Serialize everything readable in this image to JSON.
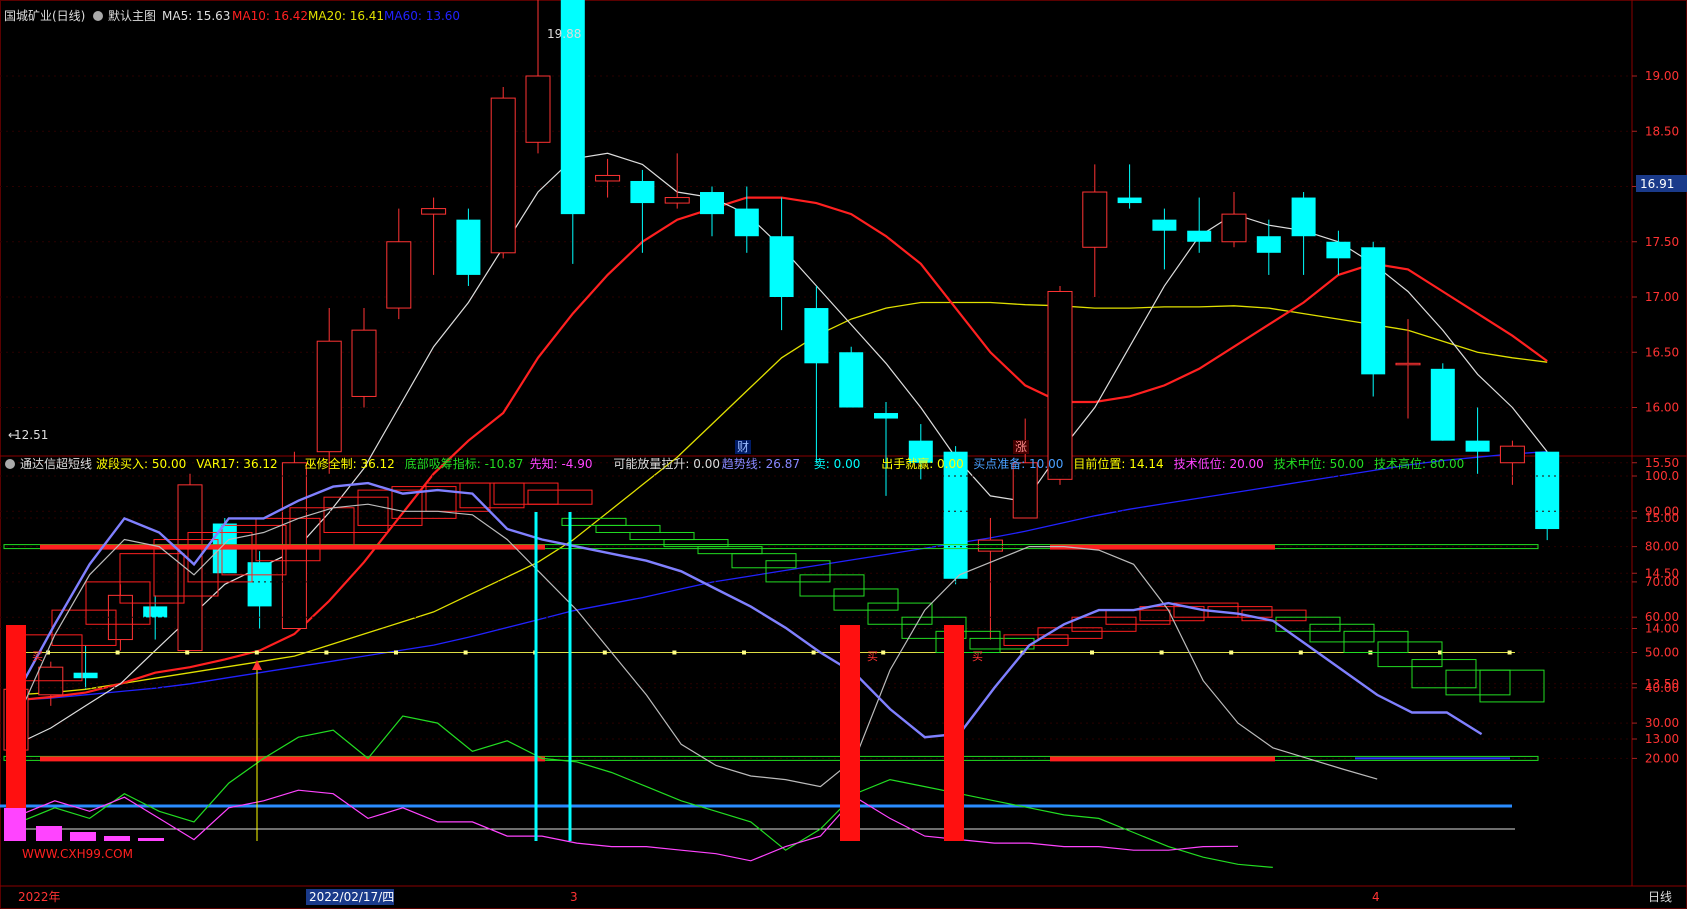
{
  "header": {
    "stock_title": "国城矿业(日线)",
    "template_label": "默认主图",
    "ma5_label": "MA5: 15.63",
    "ma10_label": "MA10: 16.42",
    "ma20_label": "MA20: 16.41",
    "ma60_label": "MA60: 13.60"
  },
  "indicator_header": {
    "name": "通达信超短线",
    "items": [
      {
        "text": "波段买入: 50.00",
        "color": "#ffff00"
      },
      {
        "text": "VAR17: 36.12",
        "color": "#ffff00"
      },
      {
        "text": "巫修全制: 36.12",
        "color": "#ffff00"
      },
      {
        "text": "底部吸筹指标: -10.87",
        "color": "#22dd22"
      },
      {
        "text": "先知: -4.90",
        "color": "#ff44ff"
      },
      {
        "text": "可能放量拉升: 0.00",
        "color": "#dddddd"
      },
      {
        "text": "趋势线: 26.87",
        "color": "#8888ff"
      },
      {
        "text": "卖: 0.00",
        "color": "#00ffff"
      },
      {
        "text": "出手就赢: 0.00",
        "color": "#ffff00"
      },
      {
        "text": "买点准备: 10.00",
        "color": "#4aa0ff"
      },
      {
        "text": "目前位置: 14.14",
        "color": "#ffff00"
      },
      {
        "text": "技术低位: 20.00",
        "color": "#ff44ff"
      },
      {
        "text": "技术中位: 50.00",
        "color": "#22dd22"
      },
      {
        "text": "技术高位: 80.00",
        "color": "#22dd22"
      }
    ]
  },
  "price_axis": {
    "ticks": [
      "19.00",
      "18.50",
      "18.00",
      "17.50",
      "17.00",
      "16.50",
      "16.00",
      "15.50",
      "15.00",
      "14.50",
      "14.00",
      "13.50",
      "13.00"
    ],
    "current_price_label": "16.91"
  },
  "indicator_axis": {
    "ticks": [
      "100.0",
      "90.00",
      "80.00",
      "70.00",
      "60.00",
      "50.00",
      "40.00",
      "30.00",
      "20.00"
    ]
  },
  "annotations": {
    "high_label": "19.88",
    "low_label": "12.51",
    "event_cai": "财",
    "event_zhang": "涨",
    "buy_label": "买",
    "watermark_link": "WWW.CXH99.COM"
  },
  "time_axis": {
    "labels": [
      "2022年",
      "2022/02/17/四",
      "3",
      "4"
    ],
    "period_label": "日线"
  },
  "colors": {
    "up": "#ff3333",
    "down": "#00ffff",
    "ma5": "#dddddd",
    "ma10": "#ff2020",
    "ma20": "#e0e000",
    "ma60": "#2222ff",
    "grid": "#5a0000"
  },
  "chart_data": [
    {
      "type": "candlestick",
      "title": "国城矿业(日线)",
      "ylim": [
        12.4,
        20.2
      ],
      "dates_axis_labels": [
        "2022年",
        "2022/02/17/四",
        "3",
        "4"
      ],
      "candles": [
        {
          "o": 12.9,
          "h": 13.5,
          "l": 12.51,
          "c": 13.45
        },
        {
          "o": 13.4,
          "h": 13.7,
          "l": 13.3,
          "c": 13.65
        },
        {
          "o": 13.6,
          "h": 13.85,
          "l": 13.45,
          "c": 13.55
        },
        {
          "o": 13.9,
          "h": 14.4,
          "l": 13.8,
          "c": 14.3
        },
        {
          "o": 14.2,
          "h": 14.3,
          "l": 13.9,
          "c": 14.1
        },
        {
          "o": 13.8,
          "h": 15.4,
          "l": 13.8,
          "c": 15.3
        },
        {
          "o": 14.95,
          "h": 15.0,
          "l": 14.5,
          "c": 14.5
        },
        {
          "o": 14.6,
          "h": 14.7,
          "l": 14.0,
          "c": 14.2
        },
        {
          "o": 14.0,
          "h": 15.6,
          "l": 14.0,
          "c": 15.5
        },
        {
          "o": 15.6,
          "h": 16.9,
          "l": 15.4,
          "c": 16.6
        },
        {
          "o": 16.1,
          "h": 16.9,
          "l": 16.0,
          "c": 16.7
        },
        {
          "o": 16.9,
          "h": 17.8,
          "l": 16.8,
          "c": 17.5
        },
        {
          "o": 17.75,
          "h": 17.9,
          "l": 17.2,
          "c": 17.8
        },
        {
          "o": 17.7,
          "h": 17.8,
          "l": 17.1,
          "c": 17.2
        },
        {
          "o": 17.4,
          "h": 18.9,
          "l": 17.35,
          "c": 18.8
        },
        {
          "o": 18.4,
          "h": 19.7,
          "l": 18.3,
          "c": 19.0
        },
        {
          "o": 19.88,
          "h": 19.88,
          "l": 17.3,
          "c": 17.75
        },
        {
          "o": 18.05,
          "h": 18.25,
          "l": 17.9,
          "c": 18.1
        },
        {
          "o": 18.05,
          "h": 18.15,
          "l": 17.4,
          "c": 17.85
        },
        {
          "o": 17.85,
          "h": 18.3,
          "l": 17.8,
          "c": 17.9
        },
        {
          "o": 17.95,
          "h": 18.0,
          "l": 17.55,
          "c": 17.75
        },
        {
          "o": 17.8,
          "h": 18.0,
          "l": 17.4,
          "c": 17.55
        },
        {
          "o": 17.55,
          "h": 17.9,
          "l": 16.7,
          "c": 17.0
        },
        {
          "o": 16.9,
          "h": 17.1,
          "l": 15.5,
          "c": 16.4
        },
        {
          "o": 16.5,
          "h": 16.55,
          "l": 16.0,
          "c": 16.0
        },
        {
          "o": 15.95,
          "h": 16.05,
          "l": 15.2,
          "c": 15.9
        },
        {
          "o": 15.7,
          "h": 15.85,
          "l": 15.35,
          "c": 15.5
        },
        {
          "o": 15.6,
          "h": 15.65,
          "l": 14.4,
          "c": 14.45
        },
        {
          "o": 14.7,
          "h": 15.0,
          "l": 13.9,
          "c": 14.8
        },
        {
          "o": 15.0,
          "h": 15.9,
          "l": 15.0,
          "c": 15.5
        },
        {
          "o": 15.35,
          "h": 17.1,
          "l": 15.3,
          "c": 17.05
        },
        {
          "o": 17.45,
          "h": 18.2,
          "l": 17.0,
          "c": 17.95
        },
        {
          "o": 17.9,
          "h": 18.2,
          "l": 17.8,
          "c": 17.85
        },
        {
          "o": 17.7,
          "h": 17.8,
          "l": 17.25,
          "c": 17.6
        },
        {
          "o": 17.6,
          "h": 17.9,
          "l": 17.4,
          "c": 17.5
        },
        {
          "o": 17.5,
          "h": 17.95,
          "l": 17.45,
          "c": 17.75
        },
        {
          "o": 17.55,
          "h": 17.7,
          "l": 17.2,
          "c": 17.4
        },
        {
          "o": 17.9,
          "h": 17.95,
          "l": 17.2,
          "c": 17.55
        },
        {
          "o": 17.5,
          "h": 17.6,
          "l": 17.2,
          "c": 17.35
        },
        {
          "o": 17.45,
          "h": 17.5,
          "l": 16.1,
          "c": 16.3
        },
        {
          "o": 16.4,
          "h": 16.8,
          "l": 15.9,
          "c": 16.4
        },
        {
          "o": 16.35,
          "h": 16.4,
          "l": 15.7,
          "c": 15.7
        },
        {
          "o": 15.7,
          "h": 16.0,
          "l": 15.4,
          "c": 15.6
        },
        {
          "o": 15.5,
          "h": 15.7,
          "l": 15.3,
          "c": 15.65
        },
        {
          "o": 15.6,
          "h": 15.6,
          "l": 14.8,
          "c": 14.9
        }
      ],
      "ma5": [
        12.95,
        13.1,
        13.3,
        13.5,
        13.8,
        14.1,
        14.4,
        14.55,
        14.7,
        15.05,
        15.45,
        16.0,
        16.55,
        16.95,
        17.45,
        17.95,
        18.25,
        18.3,
        18.2,
        17.95,
        17.9,
        17.75,
        17.45,
        17.1,
        16.75,
        16.4,
        16.0,
        15.55,
        15.2,
        15.15,
        15.6,
        16.0,
        16.55,
        17.1,
        17.55,
        17.75,
        17.65,
        17.6,
        17.5,
        17.3,
        17.05,
        16.7,
        16.3,
        16.0,
        15.6
      ],
      "ma10": [
        13.35,
        13.38,
        13.42,
        13.5,
        13.6,
        13.65,
        13.72,
        13.8,
        13.95,
        14.25,
        14.6,
        15.0,
        15.4,
        15.7,
        15.95,
        16.45,
        16.85,
        17.2,
        17.5,
        17.7,
        17.8,
        17.9,
        17.9,
        17.85,
        17.75,
        17.55,
        17.3,
        16.9,
        16.5,
        16.2,
        16.05,
        16.05,
        16.1,
        16.2,
        16.35,
        16.55,
        16.75,
        16.95,
        17.2,
        17.3,
        17.25,
        17.05,
        16.85,
        16.65,
        16.42
      ],
      "ma20": [
        13.4,
        13.42,
        13.45,
        13.5,
        13.55,
        13.6,
        13.65,
        13.7,
        13.75,
        13.85,
        13.95,
        14.05,
        14.15,
        14.3,
        14.45,
        14.6,
        14.8,
        15.05,
        15.3,
        15.55,
        15.85,
        16.15,
        16.45,
        16.65,
        16.8,
        16.9,
        16.95,
        16.95,
        16.95,
        16.93,
        16.92,
        16.9,
        16.9,
        16.91,
        16.91,
        16.92,
        16.9,
        16.85,
        16.8,
        16.75,
        16.7,
        16.6,
        16.5,
        16.45,
        16.41
      ],
      "ma60": [
        13.35,
        13.37,
        13.4,
        13.43,
        13.46,
        13.5,
        13.55,
        13.6,
        13.65,
        13.7,
        13.75,
        13.8,
        13.85,
        13.92,
        14.0,
        14.08,
        14.16,
        14.22,
        14.28,
        14.35,
        14.42,
        14.47,
        14.52,
        14.57,
        14.62,
        14.67,
        14.72,
        14.77,
        14.82,
        14.88,
        14.95,
        15.02,
        15.08,
        15.13,
        15.18,
        15.23,
        15.28,
        15.33,
        15.38,
        15.43,
        15.48,
        15.52,
        15.55,
        15.58,
        15.6
      ]
    },
    {
      "type": "line",
      "title": "通达信超短线",
      "ylim": [
        0,
        105
      ],
      "reference_lines": [
        20,
        50,
        80
      ],
      "series": [
        {
          "name": "趋势线",
          "values": [
            40,
            58,
            75,
            88,
            84,
            75,
            88,
            88,
            93,
            97,
            98,
            95,
            96,
            95,
            85,
            82,
            80,
            78,
            76,
            73,
            68,
            63,
            57,
            50,
            44,
            34,
            26,
            27,
            40,
            52,
            58,
            62,
            62,
            64,
            62,
            61,
            59,
            52,
            45,
            38,
            33,
            33,
            26.87
          ]
        },
        {
          "name": "目前位置",
          "values": [
            33,
            55,
            72,
            82,
            80,
            72,
            82,
            84,
            88,
            91,
            92,
            90,
            90,
            89,
            82,
            72,
            62,
            50,
            38,
            24,
            18,
            15,
            14,
            12,
            20,
            45,
            62,
            72,
            76,
            80,
            80,
            79,
            75,
            62,
            42,
            30,
            23,
            20,
            17,
            14.14
          ]
        },
        {
          "name": "底部吸筹指标",
          "values": [
            2,
            6,
            3,
            10,
            5,
            2,
            13,
            20,
            26,
            28,
            20,
            32,
            30,
            22,
            25,
            20,
            19,
            16,
            12,
            8,
            5,
            2,
            -6,
            0,
            10,
            14,
            12,
            10,
            8,
            6,
            4,
            3,
            -1,
            -5,
            -8,
            -10,
            -10.87
          ]
        },
        {
          "name": "先知",
          "values": [
            4,
            8,
            5,
            9,
            3,
            -3,
            6,
            8,
            11,
            10,
            3,
            6,
            2,
            2,
            -2,
            -2,
            -4,
            -5,
            -5,
            -6,
            -7,
            -9,
            -5,
            -2,
            9,
            3,
            -2,
            -3,
            -4,
            -4,
            -5,
            -5,
            -6,
            -6,
            -5,
            -4.9
          ]
        }
      ]
    }
  ]
}
